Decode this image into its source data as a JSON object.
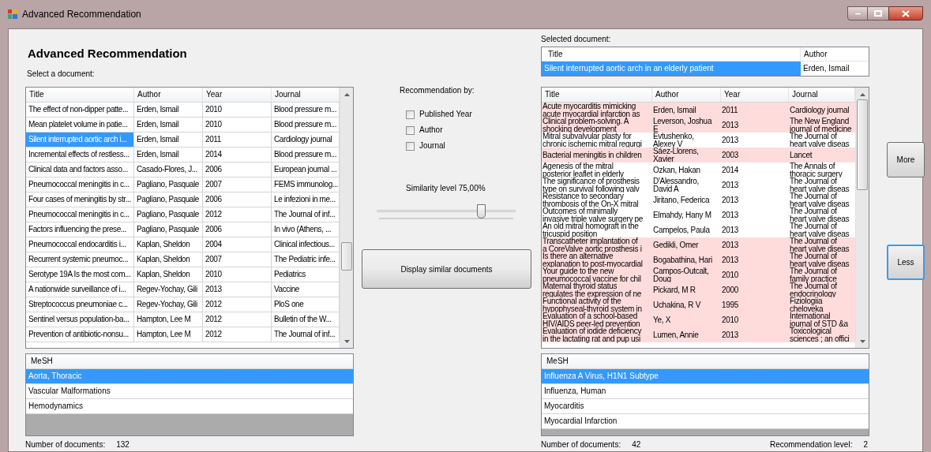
{
  "window": {
    "title": "Advanced Recommendation"
  },
  "heading": "Advanced Recommendation",
  "select_label": "Select a document:",
  "documents": {
    "columns": [
      "Title",
      "Author",
      "Year",
      "Journal"
    ],
    "rows": [
      {
        "title": "The effect of non-dipper patte...",
        "author": "Erden, Ismail",
        "year": "2010",
        "journal": "Blood pressure m...",
        "selected": false
      },
      {
        "title": "Mean platelet volume in patie...",
        "author": "Erden, Ismail",
        "year": "2010",
        "journal": "Blood pressure m...",
        "selected": false
      },
      {
        "title": "Silent interrupted aortic arch i...",
        "author": "Erden, Ismail",
        "year": "2011",
        "journal": "Cardiology journal",
        "selected": true
      },
      {
        "title": "Incremental effects of restless...",
        "author": "Erden, Ismail",
        "year": "2014",
        "journal": "Blood pressure m...",
        "selected": false
      },
      {
        "title": "Clinical data and factors asso...",
        "author": "Casado-Flores, J...",
        "year": "2006",
        "journal": "European journal ...",
        "selected": false
      },
      {
        "title": "Pneumococcal meningitis in c...",
        "author": "Pagliano, Pasquale",
        "year": "2007",
        "journal": "FEMS immunolog...",
        "selected": false
      },
      {
        "title": "Four cases of meningitis by str...",
        "author": "Pagliano, Pasquale",
        "year": "2006",
        "journal": "Le infezioni in me...",
        "selected": false
      },
      {
        "title": "Pneumococcal meningitis in c...",
        "author": "Pagliano, Pasquale",
        "year": "2012",
        "journal": "The Journal of inf...",
        "selected": false
      },
      {
        "title": "Factors influencing the prese...",
        "author": "Pagliano, Pasquale",
        "year": "2006",
        "journal": "In vivo (Athens, ...",
        "selected": false
      },
      {
        "title": "Pneumococcal endocarditis i...",
        "author": "Kaplan, Sheldon",
        "year": "2004",
        "journal": "Clinical infectious...",
        "selected": false
      },
      {
        "title": "Recurrent systemic pneumoc...",
        "author": "Kaplan, Sheldon",
        "year": "2007",
        "journal": "The Pediatric infe...",
        "selected": false
      },
      {
        "title": "Serotype 19A Is the most com...",
        "author": "Kaplan, Sheldon",
        "year": "2010",
        "journal": "Pediatrics",
        "selected": false
      },
      {
        "title": "A nationwide surveillance of i...",
        "author": "Regev-Yochay, Gili",
        "year": "2013",
        "journal": "Vaccine",
        "selected": false
      },
      {
        "title": "Streptococcus pneumoniae c...",
        "author": "Regev-Yochay, Gili",
        "year": "2012",
        "journal": "PloS one",
        "selected": false
      },
      {
        "title": "Sentinel versus population-ba...",
        "author": "Hampton, Lee M",
        "year": "2012",
        "journal": "Bulletin of the W...",
        "selected": false
      },
      {
        "title": "Prevention of antibiotic-nonsu...",
        "author": "Hampton, Lee M",
        "year": "2012",
        "journal": "The Journal of inf...",
        "selected": false
      }
    ]
  },
  "left_mesh": {
    "header": "MeSH",
    "items": [
      {
        "label": "Aorta, Thoracic",
        "selected": true
      },
      {
        "label": "Vascular Malformations",
        "selected": false
      },
      {
        "label": "Hemodynamics",
        "selected": false
      }
    ]
  },
  "left_count": {
    "label": "Number of documents:",
    "value": "132"
  },
  "recommendation": {
    "label": "Recommendation by:",
    "options": [
      {
        "label": "Published Year",
        "checked": false
      },
      {
        "label": "Author",
        "checked": false
      },
      {
        "label": "Journal",
        "checked": false
      }
    ],
    "similarity": {
      "label": "Similarity level 75,00%",
      "level": 0.75
    },
    "button": "Display similar documents"
  },
  "selected_document": {
    "label": "Selected document:",
    "columns": [
      "Title",
      "Author"
    ],
    "row": {
      "title": "Silent interrupted aortic arch in an elderly patient",
      "author": "Erden, Ismail",
      "selected": true
    }
  },
  "similar": {
    "columns": [
      "Title",
      "Author",
      "Year",
      "Journal"
    ],
    "rows": [
      {
        "title": "Acute myocarditis mimicking\nacute myocardial infarction as",
        "author": "Erden, Ismail",
        "year": "2011",
        "journal": "Cardiology journal",
        "highlighted": true
      },
      {
        "title": "Clinical problem-solving. A\nshocking development",
        "author": "Leverson, Joshua\nE",
        "year": "2013",
        "journal": "The New England\njournal of medicine",
        "highlighted": true
      },
      {
        "title": "Mitral subvalvular plasty for\nchronic ischemic mitral regurgi",
        "author": "Evtushenko,\nAlexey V",
        "year": "2013",
        "journal": "The Journal of\nheart valve diseas",
        "highlighted": false
      },
      {
        "title": "Bacterial meningitis in children",
        "author": "Sáez-Llorens,\nXavier",
        "year": "2003",
        "journal": "Lancet",
        "highlighted": true
      },
      {
        "title": "Agenesis of the mitral\nposterior leaflet in elderly",
        "author": "Ozkan, Hakan",
        "year": "2014",
        "journal": "The Annals of\nthoracic surgery",
        "highlighted": false
      },
      {
        "title": "The significance of prosthesis\ntype on survival following valv",
        "author": "D'Alessandro,\nDavid A",
        "year": "2013",
        "journal": "The Journal of\nheart valve diseas",
        "highlighted": false
      },
      {
        "title": "Resistance to secondary\nthrombosis of the On-X mitral",
        "author": "Jiritano, Federica",
        "year": "2013",
        "journal": "The Journal of\nheart valve diseas",
        "highlighted": false
      },
      {
        "title": "Outcomes of minimally\ninvasive triple valve surgery pe",
        "author": "Elmahdy, Hany M",
        "year": "2013",
        "journal": "The Journal of\nheart valve diseas",
        "highlighted": false
      },
      {
        "title": "An old mitral homograft in the\ntricuspid position",
        "author": "Campelos, Paula",
        "year": "2013",
        "journal": "The Journal of\nheart valve diseas",
        "highlighted": false
      },
      {
        "title": "Transcatheter implantation of\na CoreValve aortic prosthesis i",
        "author": "Gedikli, Omer",
        "year": "2013",
        "journal": "The Journal of\nheart valve diseas",
        "highlighted": true
      },
      {
        "title": "Is there an alternative\nexplanation to post-myocardial",
        "author": "Bogabathina, Hari",
        "year": "2013",
        "journal": "The Journal of\nheart valve diseas",
        "highlighted": true
      },
      {
        "title": "Your guide to the new\npneumococcal vaccine for chil",
        "author": "Campos-Outcalt,\nDoug",
        "year": "2010",
        "journal": "The Journal of\nfamily practice",
        "highlighted": true
      },
      {
        "title": "Maternal thyroid status\nregulates the expression of ne",
        "author": "Pickard, M R",
        "year": "2000",
        "journal": "The Journal of\nendocrinology",
        "highlighted": true
      },
      {
        "title": "Functional activity of the\nhypophyseal-thyroid system in",
        "author": "Uchakina, R V",
        "year": "1995",
        "journal": "Fiziologiia\ncheloveka",
        "highlighted": true
      },
      {
        "title": "Evaluation of a school-based\nHIV/AIDS peer-led prevention",
        "author": "Ye, X",
        "year": "2010",
        "journal": "International\njournal of STD &a",
        "highlighted": true
      },
      {
        "title": "Evaluation of iodide deficiency\nin the lactating rat and pup usi",
        "author": "Lumen, Annie",
        "year": "2013",
        "journal": "Toxicological\nsciences ; an offici",
        "highlighted": true
      }
    ]
  },
  "right_mesh": {
    "header": "MeSH",
    "items": [
      {
        "label": "Influenza A Virus, H1N1 Subtype",
        "selected": true
      },
      {
        "label": "Influenza, Human",
        "selected": false
      },
      {
        "label": "Myocarditis",
        "selected": false
      },
      {
        "label": "Myocardial Infarction",
        "selected": false
      }
    ]
  },
  "right_count": {
    "label": "Number of documents:",
    "value": "42"
  },
  "recommendation_level": {
    "label": "Recommendation level:",
    "value": "2"
  },
  "side_buttons": [
    {
      "label": "More",
      "focused": false
    },
    {
      "label": "Less",
      "focused": true
    }
  ]
}
